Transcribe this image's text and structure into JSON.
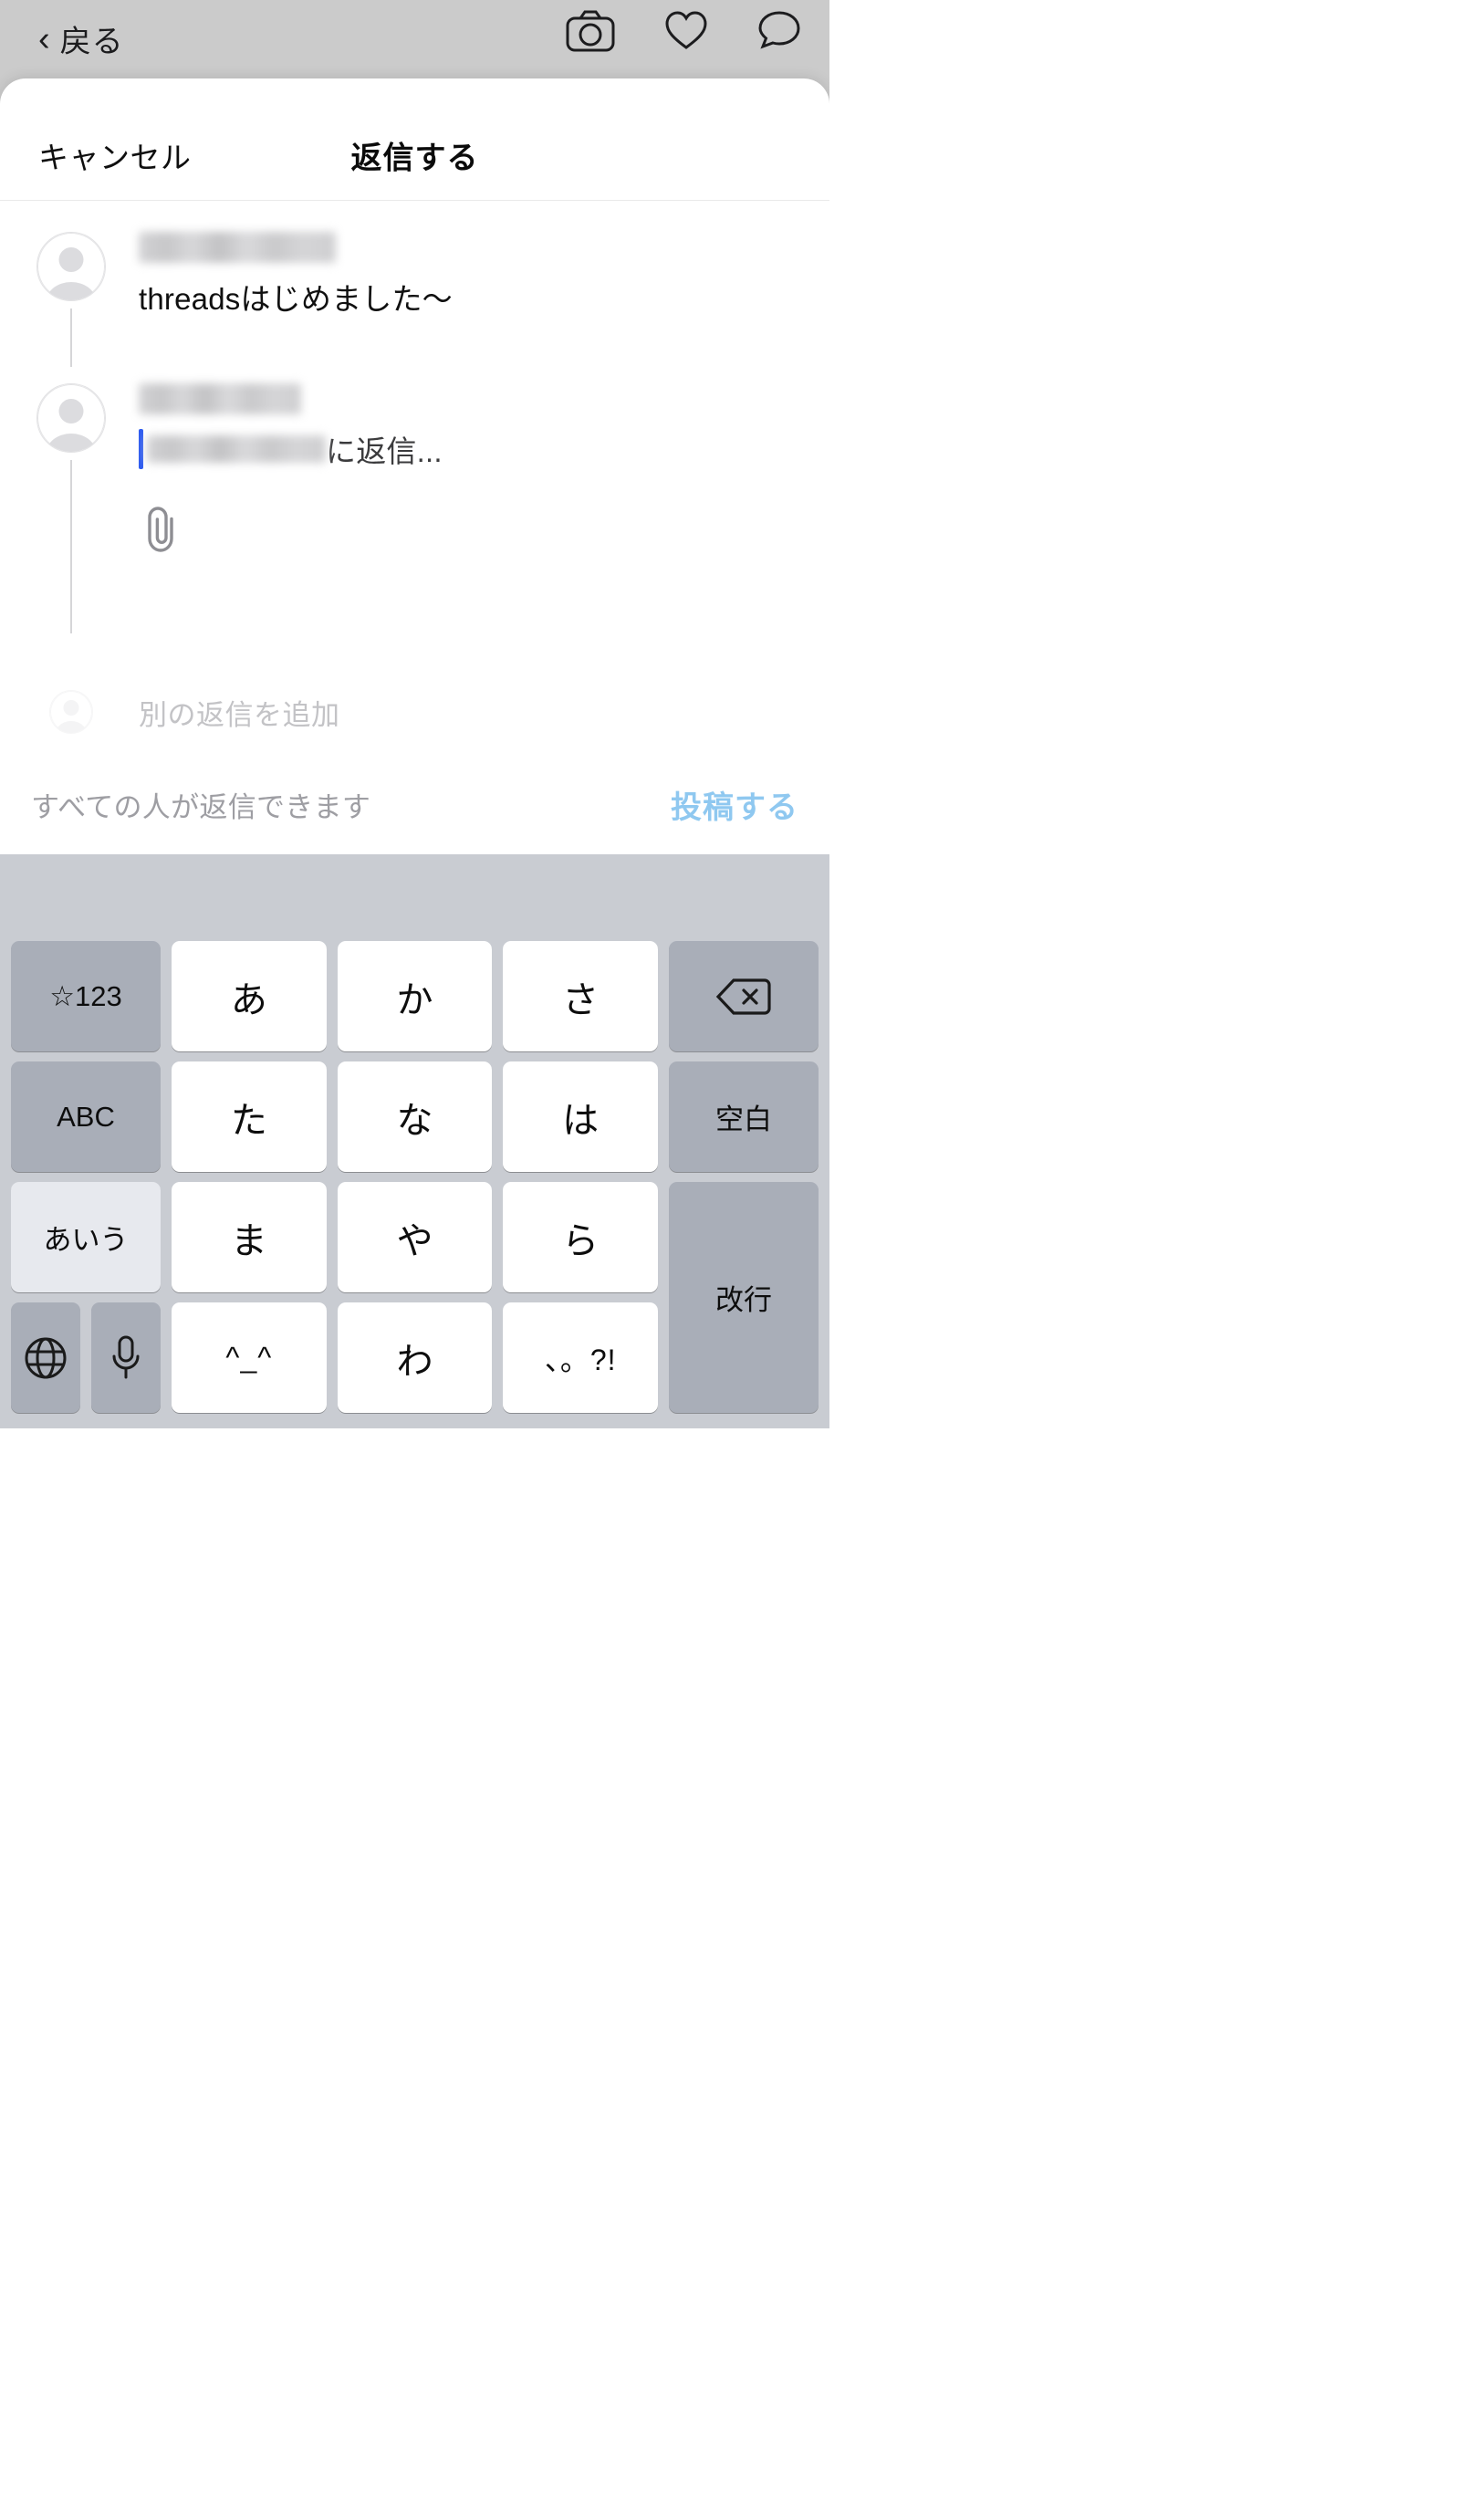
{
  "background_app": {
    "back_label": "戻る",
    "back_icon": "chevron-left-icon",
    "icons": [
      "camera-icon",
      "heart-icon",
      "message-icon"
    ]
  },
  "sheet": {
    "cancel_label": "キャンセル",
    "title": "返信する"
  },
  "thread": {
    "original_post": {
      "username_redacted": true,
      "text": "threadsはじめました〜"
    },
    "reply_draft": {
      "username_redacted": true,
      "placeholder_suffix": "に返信...",
      "attach_icon": "paperclip-icon"
    },
    "add_another_reply_label": "別の返信を追加"
  },
  "footer": {
    "audience_label": "すべての人が返信できます",
    "post_label": "投稿する",
    "post_color": "#8fc8f0"
  },
  "keyboard": {
    "rows": [
      [
        {
          "label": "☆123",
          "type": "fn"
        },
        {
          "label": "あ",
          "type": "char"
        },
        {
          "label": "か",
          "type": "char"
        },
        {
          "label": "さ",
          "type": "char"
        },
        {
          "label": "backspace-icon",
          "type": "fn-icon"
        }
      ],
      [
        {
          "label": "ABC",
          "type": "fn"
        },
        {
          "label": "た",
          "type": "char"
        },
        {
          "label": "な",
          "type": "char"
        },
        {
          "label": "は",
          "type": "char"
        },
        {
          "label": "空白",
          "type": "fn"
        }
      ],
      [
        {
          "label": "あいう",
          "type": "fn-light"
        },
        {
          "label": "ま",
          "type": "char"
        },
        {
          "label": "や",
          "type": "char"
        },
        {
          "label": "ら",
          "type": "char"
        },
        {
          "label": "改行",
          "type": "fn"
        }
      ],
      [
        {
          "label": "globe-icon",
          "type": "fn-icon"
        },
        {
          "label": "mic-icon",
          "type": "fn-icon"
        },
        {
          "label": "^_^",
          "type": "char"
        },
        {
          "label": "わ",
          "type": "char"
        },
        {
          "label": "、。?!",
          "type": "char"
        }
      ]
    ]
  }
}
